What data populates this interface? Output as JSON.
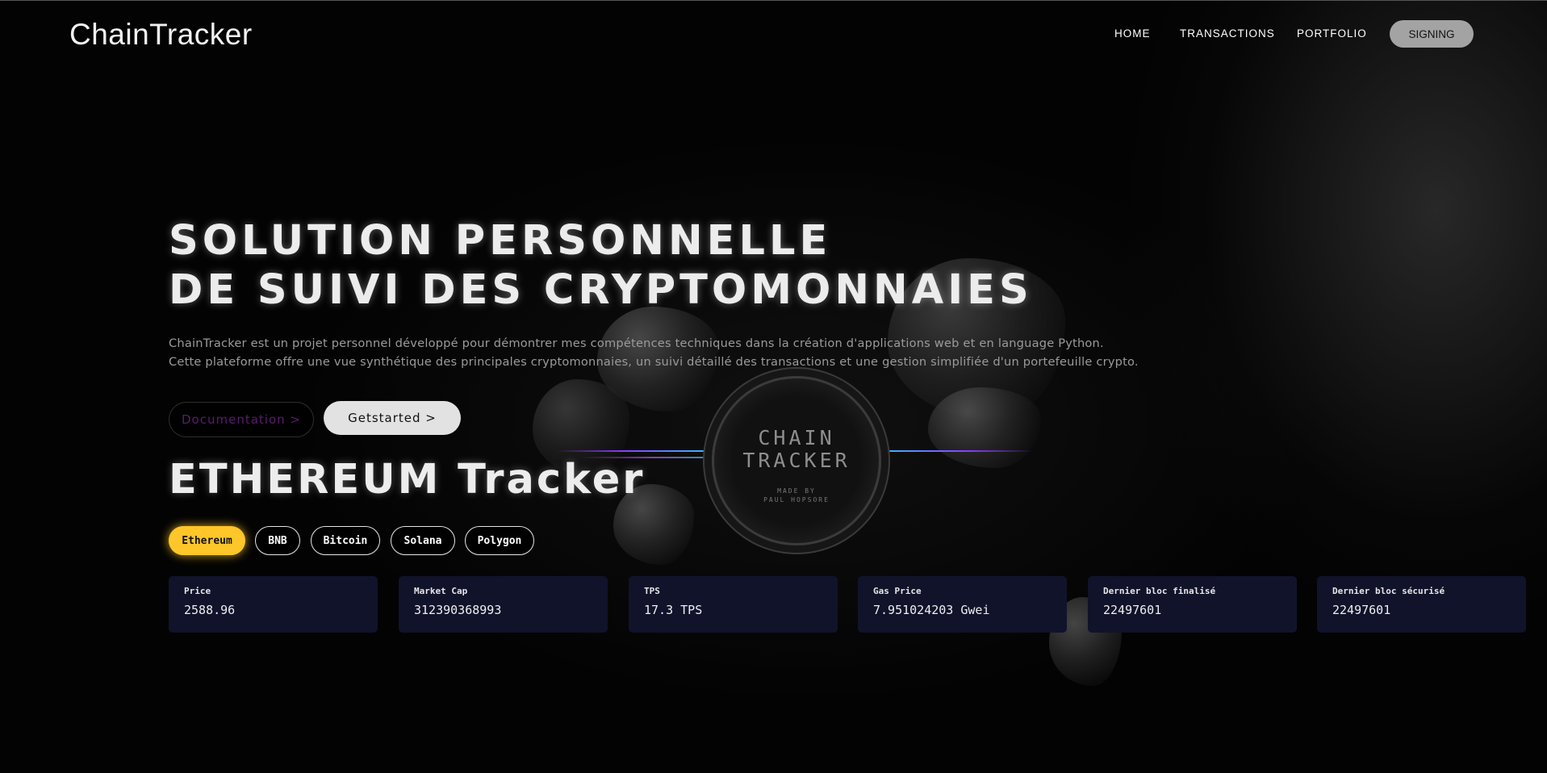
{
  "header": {
    "logo": "ChainTracker",
    "nav": [
      {
        "label": "HOME"
      },
      {
        "label": "TRANSACTIONS"
      },
      {
        "label": "PORTFOLIO"
      }
    ],
    "signing_label": "SIGNING"
  },
  "hero": {
    "title_line1": "SOLUTION PERSONNELLE",
    "title_line2": "DE SUIVI DES CRYPTOMONNAIES",
    "desc_line1": "ChainTracker est un projet personnel développé pour démontrer mes compétences techniques dans la création d'applications web et en language Python.",
    "desc_line2": "Cette plateforme offre une vue synthétique des principales cryptomonnaies, un suivi détaillé des transactions et une gestion simplifiée d'un portefeuille crypto.",
    "doc_button": "Documentation >",
    "start_button": "Getstarted >"
  },
  "badge": {
    "line1": "CHAIN",
    "line2": "TRACKER",
    "sub1": "MADE BY",
    "sub2": "PAUL HOPSORE"
  },
  "tracker": {
    "title": "ETHEREUM Tracker",
    "chains": [
      {
        "label": "Ethereum",
        "active": true
      },
      {
        "label": "BNB",
        "active": false
      },
      {
        "label": "Bitcoin",
        "active": false
      },
      {
        "label": "Solana",
        "active": false
      },
      {
        "label": "Polygon",
        "active": false
      }
    ],
    "active_color": "#ffc629",
    "cards": [
      {
        "label": "Price",
        "value": "2588.96"
      },
      {
        "label": "Market Cap",
        "value": "312390368993"
      },
      {
        "label": "TPS",
        "value": "17.3 TPS"
      },
      {
        "label": "Gas Price",
        "value": "7.951024203 Gwei"
      },
      {
        "label": "Dernier bloc finalisé",
        "value": "22497601"
      },
      {
        "label": "Dernier bloc sécurisé",
        "value": "22497601"
      }
    ]
  },
  "colors": {
    "background": "#030303",
    "card_background": "#11132b",
    "signing_button": "#a3a3a3"
  }
}
